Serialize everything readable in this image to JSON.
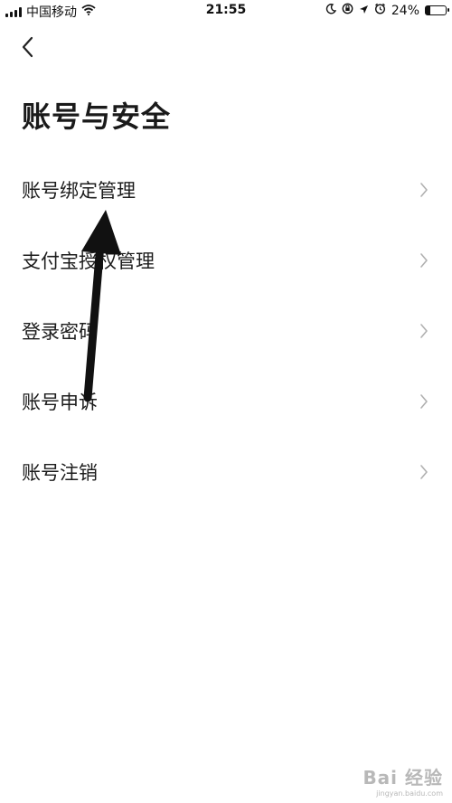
{
  "status_bar": {
    "carrier": "中国移动",
    "time": "21:55",
    "battery_percent": "24%",
    "battery_level": 0.24,
    "icons": [
      "signal-icon",
      "wifi-icon",
      "moon-icon",
      "orientation-lock-icon",
      "location-icon",
      "alarm-icon",
      "battery-icon"
    ]
  },
  "nav": {
    "back_icon": "chevron-left-icon"
  },
  "page": {
    "title": "账号与安全"
  },
  "menu": {
    "items": [
      {
        "label": "账号绑定管理",
        "icon": "chevron-right-icon"
      },
      {
        "label": "支付宝授权管理",
        "icon": "chevron-right-icon"
      },
      {
        "label": "登录密码",
        "icon": "chevron-right-icon"
      },
      {
        "label": "账号申诉",
        "icon": "chevron-right-icon"
      },
      {
        "label": "账号注销",
        "icon": "chevron-right-icon"
      }
    ]
  },
  "annotation": {
    "icon": "arrow-annotation-icon",
    "color": "#111111"
  },
  "watermark": {
    "brand": "Bai 经验",
    "sub": "jingyan.baidu.com"
  },
  "colors": {
    "background": "#ffffff",
    "text": "#1a1a1a",
    "chevron": "#b0b0b0"
  }
}
